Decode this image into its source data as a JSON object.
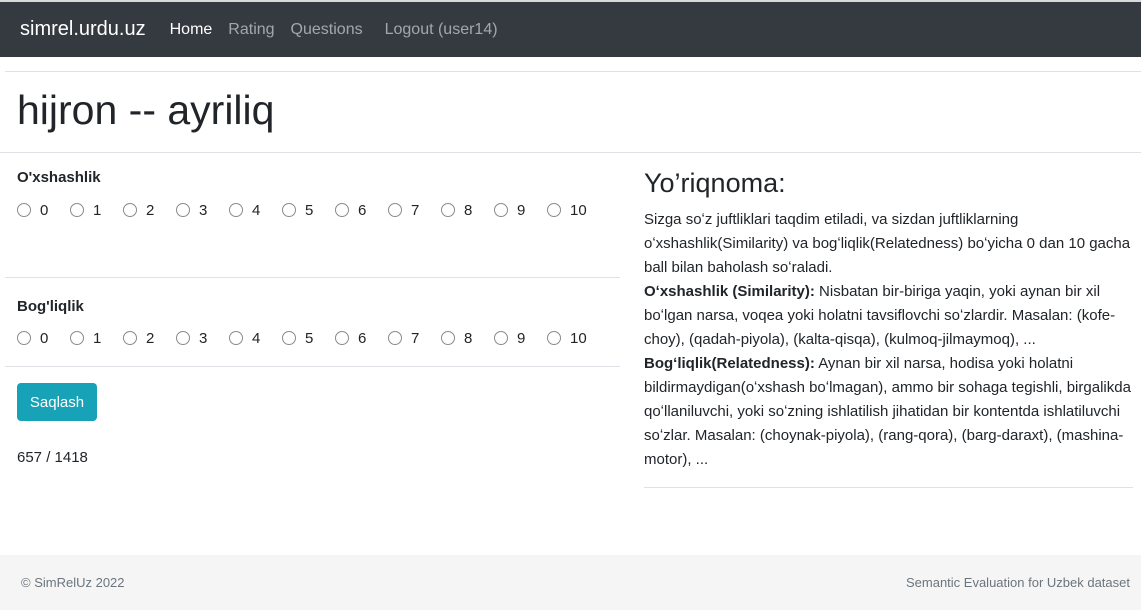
{
  "nav": {
    "brand": "simrel.urdu.uz",
    "links": [
      "Home",
      "Rating",
      "Questions"
    ],
    "logout": "Logout (user14)"
  },
  "page": {
    "title": "hijron -- ayriliq"
  },
  "form": {
    "similarity_label": "O'xshashlik",
    "relatedness_label": "Bog'liqlik",
    "options": [
      "0",
      "1",
      "2",
      "3",
      "4",
      "5",
      "6",
      "7",
      "8",
      "9",
      "10"
    ],
    "save_label": "Saqlash",
    "progress": "657 / 1418"
  },
  "guide": {
    "title": "Yo’riqnoma:",
    "intro": "Sizga soʻz juftliklari taqdim etiladi, va sizdan juftliklarning oʻxshashlik(Similarity) va bogʻliqlik(Relatedness) boʻyicha 0 dan 10 gacha ball bilan baholash soʻraladi.",
    "sim_term": "Oʻxshashlik (Similarity):",
    "sim_text": " Nisbatan bir-biriga yaqin, yoki aynan bir xil boʻlgan narsa, voqea yoki holatni tavsiflovchi soʻzlardir. Masalan: (kofe-choy), (qadah-piyola), (kalta-qisqa), (kulmoq-jilmaymoq), ...",
    "rel_term": "Bogʻliqlik(Relatedness):",
    "rel_text": " Aynan bir xil narsa, hodisa yoki holatni bildirmaydigan(oʻxshash boʻlmagan), ammo bir sohaga tegishli, birgalikda qoʻllaniluvchi, yoki soʻzning ishlatilish jihatidan bir kontentda ishlatiluvchi soʻzlar. Masalan: (choynak-piyola), (rang-qora), (barg-daraxt), (mashina-motor), ..."
  },
  "footer": {
    "left": "© SimRelUz 2022",
    "right": "Semantic Evaluation for Uzbek dataset"
  }
}
